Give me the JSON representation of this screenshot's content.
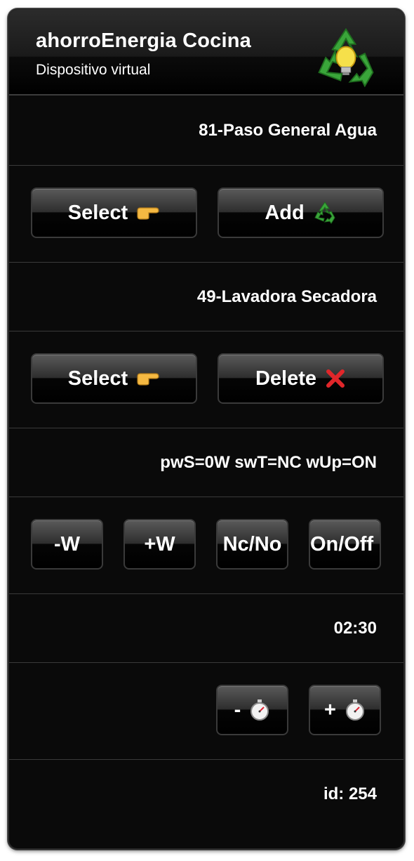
{
  "header": {
    "title": "ahorroEnergia Cocina",
    "subtitle": "Dispositivo virtual",
    "logo_icon": "recycle-bulb-icon"
  },
  "rows": {
    "program1": "81-Paso General Agua",
    "program2": "49-Lavadora Secadora",
    "status": "pwS=0W swT=NC wUp=ON",
    "time": "02:30",
    "id": "id: 254"
  },
  "buttons": {
    "select1": {
      "label": "Select",
      "icon": "pointing-hand-icon"
    },
    "add": {
      "label": "Add",
      "icon": "recycle-icon"
    },
    "select2": {
      "label": "Select",
      "icon": "pointing-hand-icon"
    },
    "delete": {
      "label": "Delete",
      "icon": "red-x-icon"
    },
    "minus_w": {
      "label": "-W"
    },
    "plus_w": {
      "label": "+W"
    },
    "nc_no": {
      "label": "Nc/No"
    },
    "on_off": {
      "label": "On/Off"
    },
    "minus_time": {
      "label": "-",
      "icon": "stopwatch-icon"
    },
    "plus_time": {
      "label": "+",
      "icon": "stopwatch-icon"
    }
  },
  "colors": {
    "background": "#0a0a0a",
    "text": "#ffffff",
    "delete_x": "#e0262a",
    "recycle_green": "#3aa53a",
    "hand_yellow": "#f5b942"
  }
}
